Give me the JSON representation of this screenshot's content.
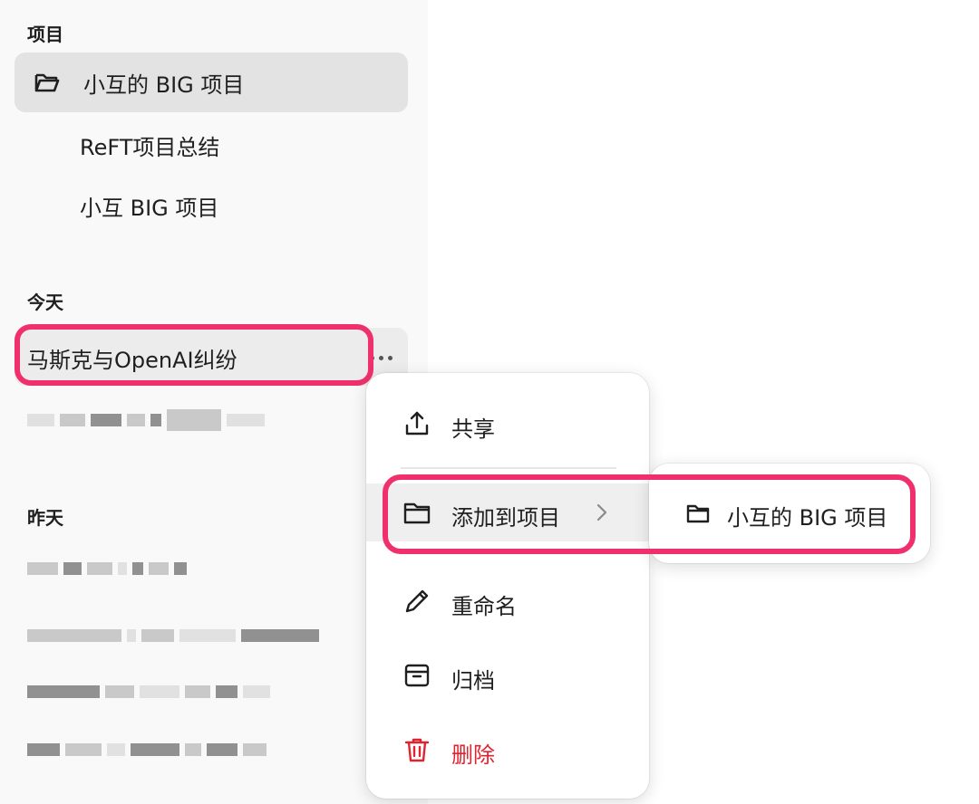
{
  "sidebar": {
    "projects_heading": "项目",
    "projects": [
      {
        "label": "小互的 BIG 项目",
        "icon": "folder-open-icon",
        "active": true
      },
      {
        "label": "ReFT项目总结"
      },
      {
        "label": "小互 BIG 项目"
      }
    ],
    "today_heading": "今天",
    "today_chat": "马斯克与OpenAI纠纷",
    "yesterday_heading": "昨天"
  },
  "context_menu": {
    "share": "共享",
    "add_to_project": "添加到项目",
    "rename": "重命名",
    "archive": "归档",
    "delete": "删除",
    "delete_color": "#e0232f"
  },
  "submenu": {
    "project": "小互的 BIG 项目"
  },
  "colors": {
    "highlight": "#f0306c",
    "active_bg": "#e3e3e3"
  }
}
